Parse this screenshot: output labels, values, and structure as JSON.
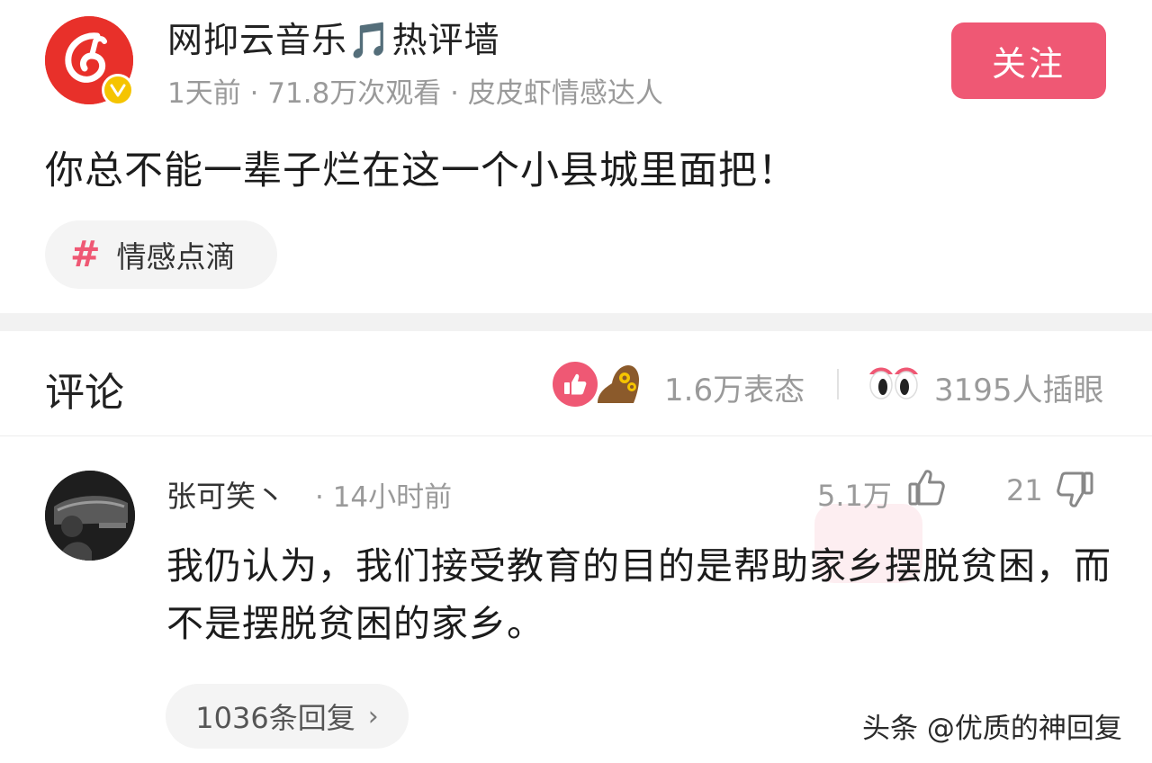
{
  "post": {
    "title": "网抑云音乐🎵热评墙",
    "meta": "1天前 · 71.8万次观看 · 皮皮虾情感达人",
    "follow_label": "关注",
    "content": "你总不能一辈子烂在这一个小县城里面把！",
    "tag": "情感点滴",
    "tag_symbol": "#"
  },
  "comments_header": {
    "title": "评论",
    "reactions": "1.6万表态",
    "views": "3195人插眼"
  },
  "comment": {
    "username": "张可笑丶",
    "time": "· 14小时前",
    "likes": "5.1万",
    "dislikes": "21",
    "text": "我仍认为，我们接受教育的目的是帮助家乡摆脱贫困，而不是摆脱贫困的家乡。",
    "replies_label": "1036条回复",
    "replies_chevron": "›"
  },
  "watermark": "头条 @优质的神回复",
  "colors": {
    "accent": "#ef5874",
    "logo_red": "#e8302a",
    "verified_yellow": "#f5c400",
    "meta_gray": "#9a9a9a"
  }
}
